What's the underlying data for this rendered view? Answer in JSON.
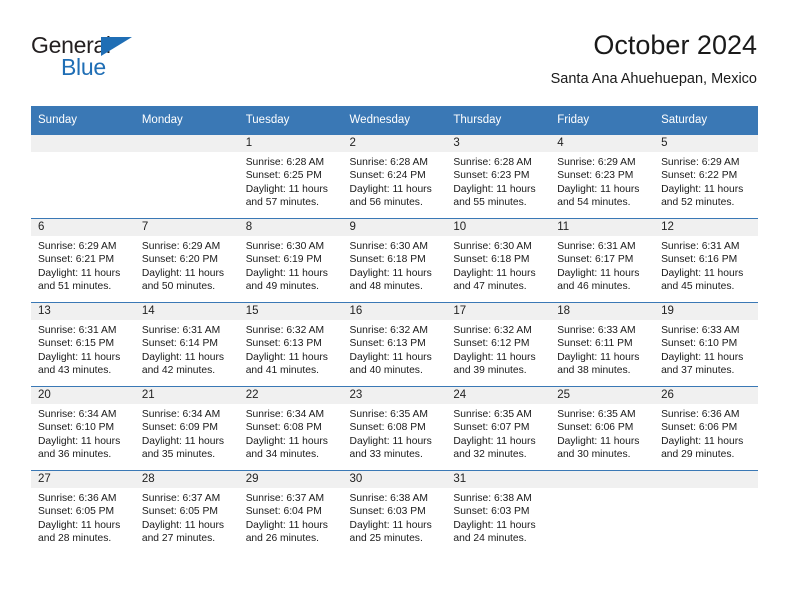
{
  "logo": {
    "word_top": "General",
    "word_bottom": "Blue",
    "triangle_color": "#1f6eb5"
  },
  "header": {
    "title": "October 2024",
    "subtitle": "Santa Ana Ahuehuepan, Mexico"
  },
  "colors": {
    "header_blue": "#3a78b5",
    "daynum_band": "#f0f0f0",
    "text": "#1a1a1a"
  },
  "calendar": {
    "weekday_headers": [
      "Sunday",
      "Monday",
      "Tuesday",
      "Wednesday",
      "Thursday",
      "Friday",
      "Saturday"
    ],
    "weeks": [
      [
        {
          "day": "",
          "empty": true,
          "sunrise": "",
          "sunset": "",
          "daylight_1": "",
          "daylight_2": ""
        },
        {
          "day": "",
          "empty": true,
          "sunrise": "",
          "sunset": "",
          "daylight_1": "",
          "daylight_2": ""
        },
        {
          "day": "1",
          "empty": false,
          "sunrise": "Sunrise: 6:28 AM",
          "sunset": "Sunset: 6:25 PM",
          "daylight_1": "Daylight: 11 hours",
          "daylight_2": "and 57 minutes."
        },
        {
          "day": "2",
          "empty": false,
          "sunrise": "Sunrise: 6:28 AM",
          "sunset": "Sunset: 6:24 PM",
          "daylight_1": "Daylight: 11 hours",
          "daylight_2": "and 56 minutes."
        },
        {
          "day": "3",
          "empty": false,
          "sunrise": "Sunrise: 6:28 AM",
          "sunset": "Sunset: 6:23 PM",
          "daylight_1": "Daylight: 11 hours",
          "daylight_2": "and 55 minutes."
        },
        {
          "day": "4",
          "empty": false,
          "sunrise": "Sunrise: 6:29 AM",
          "sunset": "Sunset: 6:23 PM",
          "daylight_1": "Daylight: 11 hours",
          "daylight_2": "and 54 minutes."
        },
        {
          "day": "5",
          "empty": false,
          "sunrise": "Sunrise: 6:29 AM",
          "sunset": "Sunset: 6:22 PM",
          "daylight_1": "Daylight: 11 hours",
          "daylight_2": "and 52 minutes."
        }
      ],
      [
        {
          "day": "6",
          "empty": false,
          "sunrise": "Sunrise: 6:29 AM",
          "sunset": "Sunset: 6:21 PM",
          "daylight_1": "Daylight: 11 hours",
          "daylight_2": "and 51 minutes."
        },
        {
          "day": "7",
          "empty": false,
          "sunrise": "Sunrise: 6:29 AM",
          "sunset": "Sunset: 6:20 PM",
          "daylight_1": "Daylight: 11 hours",
          "daylight_2": "and 50 minutes."
        },
        {
          "day": "8",
          "empty": false,
          "sunrise": "Sunrise: 6:30 AM",
          "sunset": "Sunset: 6:19 PM",
          "daylight_1": "Daylight: 11 hours",
          "daylight_2": "and 49 minutes."
        },
        {
          "day": "9",
          "empty": false,
          "sunrise": "Sunrise: 6:30 AM",
          "sunset": "Sunset: 6:18 PM",
          "daylight_1": "Daylight: 11 hours",
          "daylight_2": "and 48 minutes."
        },
        {
          "day": "10",
          "empty": false,
          "sunrise": "Sunrise: 6:30 AM",
          "sunset": "Sunset: 6:18 PM",
          "daylight_1": "Daylight: 11 hours",
          "daylight_2": "and 47 minutes."
        },
        {
          "day": "11",
          "empty": false,
          "sunrise": "Sunrise: 6:31 AM",
          "sunset": "Sunset: 6:17 PM",
          "daylight_1": "Daylight: 11 hours",
          "daylight_2": "and 46 minutes."
        },
        {
          "day": "12",
          "empty": false,
          "sunrise": "Sunrise: 6:31 AM",
          "sunset": "Sunset: 6:16 PM",
          "daylight_1": "Daylight: 11 hours",
          "daylight_2": "and 45 minutes."
        }
      ],
      [
        {
          "day": "13",
          "empty": false,
          "sunrise": "Sunrise: 6:31 AM",
          "sunset": "Sunset: 6:15 PM",
          "daylight_1": "Daylight: 11 hours",
          "daylight_2": "and 43 minutes."
        },
        {
          "day": "14",
          "empty": false,
          "sunrise": "Sunrise: 6:31 AM",
          "sunset": "Sunset: 6:14 PM",
          "daylight_1": "Daylight: 11 hours",
          "daylight_2": "and 42 minutes."
        },
        {
          "day": "15",
          "empty": false,
          "sunrise": "Sunrise: 6:32 AM",
          "sunset": "Sunset: 6:13 PM",
          "daylight_1": "Daylight: 11 hours",
          "daylight_2": "and 41 minutes."
        },
        {
          "day": "16",
          "empty": false,
          "sunrise": "Sunrise: 6:32 AM",
          "sunset": "Sunset: 6:13 PM",
          "daylight_1": "Daylight: 11 hours",
          "daylight_2": "and 40 minutes."
        },
        {
          "day": "17",
          "empty": false,
          "sunrise": "Sunrise: 6:32 AM",
          "sunset": "Sunset: 6:12 PM",
          "daylight_1": "Daylight: 11 hours",
          "daylight_2": "and 39 minutes."
        },
        {
          "day": "18",
          "empty": false,
          "sunrise": "Sunrise: 6:33 AM",
          "sunset": "Sunset: 6:11 PM",
          "daylight_1": "Daylight: 11 hours",
          "daylight_2": "and 38 minutes."
        },
        {
          "day": "19",
          "empty": false,
          "sunrise": "Sunrise: 6:33 AM",
          "sunset": "Sunset: 6:10 PM",
          "daylight_1": "Daylight: 11 hours",
          "daylight_2": "and 37 minutes."
        }
      ],
      [
        {
          "day": "20",
          "empty": false,
          "sunrise": "Sunrise: 6:34 AM",
          "sunset": "Sunset: 6:10 PM",
          "daylight_1": "Daylight: 11 hours",
          "daylight_2": "and 36 minutes."
        },
        {
          "day": "21",
          "empty": false,
          "sunrise": "Sunrise: 6:34 AM",
          "sunset": "Sunset: 6:09 PM",
          "daylight_1": "Daylight: 11 hours",
          "daylight_2": "and 35 minutes."
        },
        {
          "day": "22",
          "empty": false,
          "sunrise": "Sunrise: 6:34 AM",
          "sunset": "Sunset: 6:08 PM",
          "daylight_1": "Daylight: 11 hours",
          "daylight_2": "and 34 minutes."
        },
        {
          "day": "23",
          "empty": false,
          "sunrise": "Sunrise: 6:35 AM",
          "sunset": "Sunset: 6:08 PM",
          "daylight_1": "Daylight: 11 hours",
          "daylight_2": "and 33 minutes."
        },
        {
          "day": "24",
          "empty": false,
          "sunrise": "Sunrise: 6:35 AM",
          "sunset": "Sunset: 6:07 PM",
          "daylight_1": "Daylight: 11 hours",
          "daylight_2": "and 32 minutes."
        },
        {
          "day": "25",
          "empty": false,
          "sunrise": "Sunrise: 6:35 AM",
          "sunset": "Sunset: 6:06 PM",
          "daylight_1": "Daylight: 11 hours",
          "daylight_2": "and 30 minutes."
        },
        {
          "day": "26",
          "empty": false,
          "sunrise": "Sunrise: 6:36 AM",
          "sunset": "Sunset: 6:06 PM",
          "daylight_1": "Daylight: 11 hours",
          "daylight_2": "and 29 minutes."
        }
      ],
      [
        {
          "day": "27",
          "empty": false,
          "sunrise": "Sunrise: 6:36 AM",
          "sunset": "Sunset: 6:05 PM",
          "daylight_1": "Daylight: 11 hours",
          "daylight_2": "and 28 minutes."
        },
        {
          "day": "28",
          "empty": false,
          "sunrise": "Sunrise: 6:37 AM",
          "sunset": "Sunset: 6:05 PM",
          "daylight_1": "Daylight: 11 hours",
          "daylight_2": "and 27 minutes."
        },
        {
          "day": "29",
          "empty": false,
          "sunrise": "Sunrise: 6:37 AM",
          "sunset": "Sunset: 6:04 PM",
          "daylight_1": "Daylight: 11 hours",
          "daylight_2": "and 26 minutes."
        },
        {
          "day": "30",
          "empty": false,
          "sunrise": "Sunrise: 6:38 AM",
          "sunset": "Sunset: 6:03 PM",
          "daylight_1": "Daylight: 11 hours",
          "daylight_2": "and 25 minutes."
        },
        {
          "day": "31",
          "empty": false,
          "sunrise": "Sunrise: 6:38 AM",
          "sunset": "Sunset: 6:03 PM",
          "daylight_1": "Daylight: 11 hours",
          "daylight_2": "and 24 minutes."
        },
        {
          "day": "",
          "empty": true,
          "sunrise": "",
          "sunset": "",
          "daylight_1": "",
          "daylight_2": ""
        },
        {
          "day": "",
          "empty": true,
          "sunrise": "",
          "sunset": "",
          "daylight_1": "",
          "daylight_2": ""
        }
      ]
    ]
  }
}
